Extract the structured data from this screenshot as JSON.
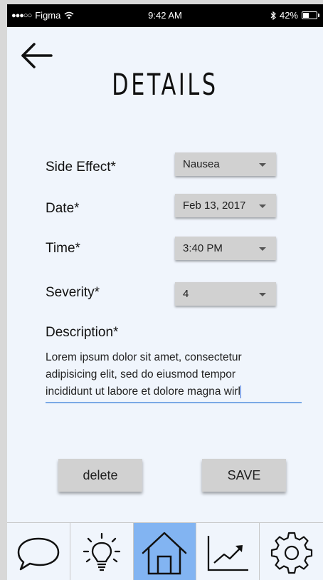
{
  "status_bar": {
    "carrier": "Figma",
    "time": "9:42 AM",
    "battery": "42%",
    "battery_level": 0.42
  },
  "header": {
    "title": "Details"
  },
  "form": {
    "side_effect": {
      "label": "Side Effect*",
      "value": "Nausea"
    },
    "date": {
      "label": "Date*",
      "value": "Feb 13, 2017"
    },
    "time": {
      "label": "Time*",
      "value": "3:40 PM"
    },
    "severity": {
      "label": "Severity*",
      "value": "4"
    },
    "description": {
      "label": "Description*",
      "lines": [
        "Lorem ipsum dolor sit amet, consectetur",
        "adipisicing elit, sed do eiusmod tempor",
        "incididunt ut labore et dolore magna wirl"
      ]
    }
  },
  "actions": {
    "delete_label": "delete",
    "save_label": "SAVE"
  },
  "tab_bar": {
    "active": "home",
    "tabs": [
      "chat-bubble-icon",
      "lightbulb-icon",
      "home-icon",
      "trend-chart-icon",
      "gear-icon"
    ]
  },
  "colors": {
    "background": "#f0f5fc",
    "control": "#d1d1d1",
    "active_tab": "#82b4f2",
    "input_underline": "#7aa9e6"
  }
}
